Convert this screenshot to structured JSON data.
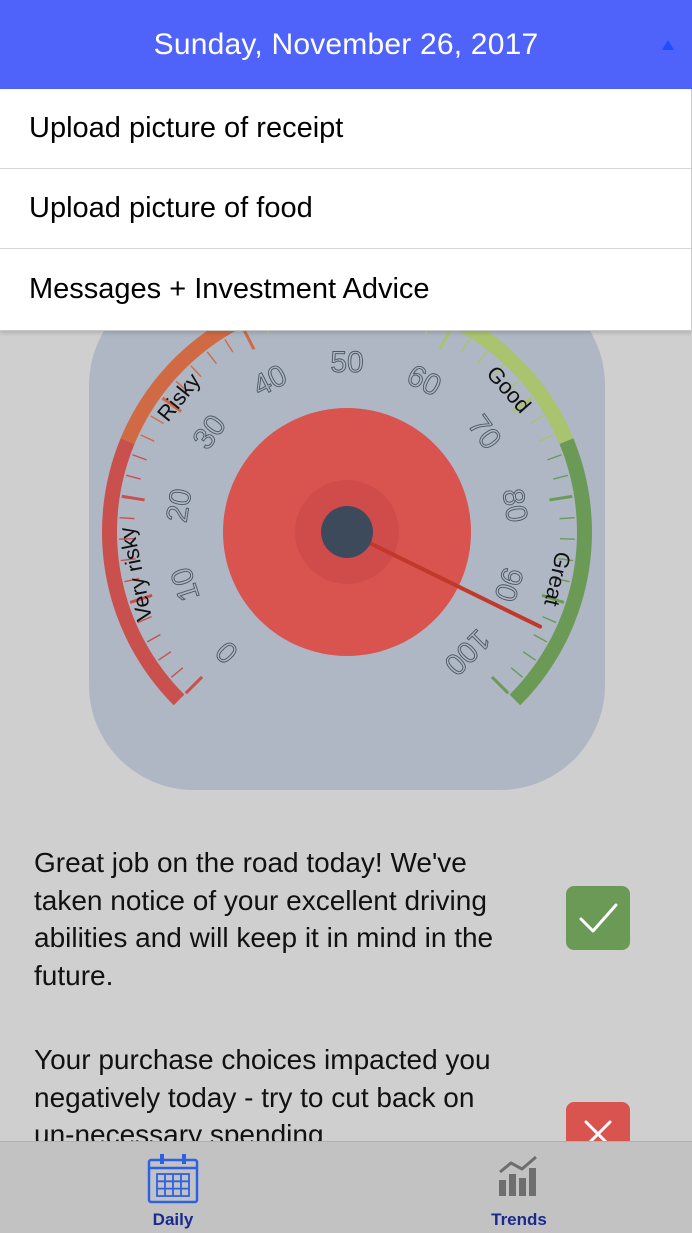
{
  "header": {
    "date": "Sunday, November 26, 2017"
  },
  "menu": {
    "items": [
      {
        "label": "Upload picture of receipt"
      },
      {
        "label": "Upload picture of food"
      },
      {
        "label": "Messages + Investment Advice"
      }
    ]
  },
  "gauge": {
    "min": 0,
    "max": 100,
    "value": 93,
    "tick_labels": [
      "0",
      "10",
      "20",
      "30",
      "40",
      "50",
      "60",
      "70",
      "80",
      "90",
      "100"
    ],
    "zones": [
      {
        "label": "Very risky",
        "color": "#c9504c"
      },
      {
        "label": "Risky",
        "color": "#cf6a44"
      },
      {
        "label": "Good",
        "color": "#a9c36e"
      },
      {
        "label": "Great",
        "color": "#6b9a57"
      }
    ],
    "center_color": "#d9534f",
    "hub_color": "#3c4a5c"
  },
  "messages": [
    {
      "text": "Great job on the road today! We've taken notice of your excellent driving abilities and will keep it in mind in the future.",
      "status_icon": "check-icon"
    },
    {
      "text": "Your purchase choices impacted you negatively today - try to cut back on un-necessary spending",
      "status_icon": "x-icon"
    }
  ],
  "tabbar": {
    "tabs": [
      {
        "label": "Daily",
        "icon": "calendar-icon"
      },
      {
        "label": "Trends",
        "icon": "bar-chart-icon"
      }
    ]
  }
}
